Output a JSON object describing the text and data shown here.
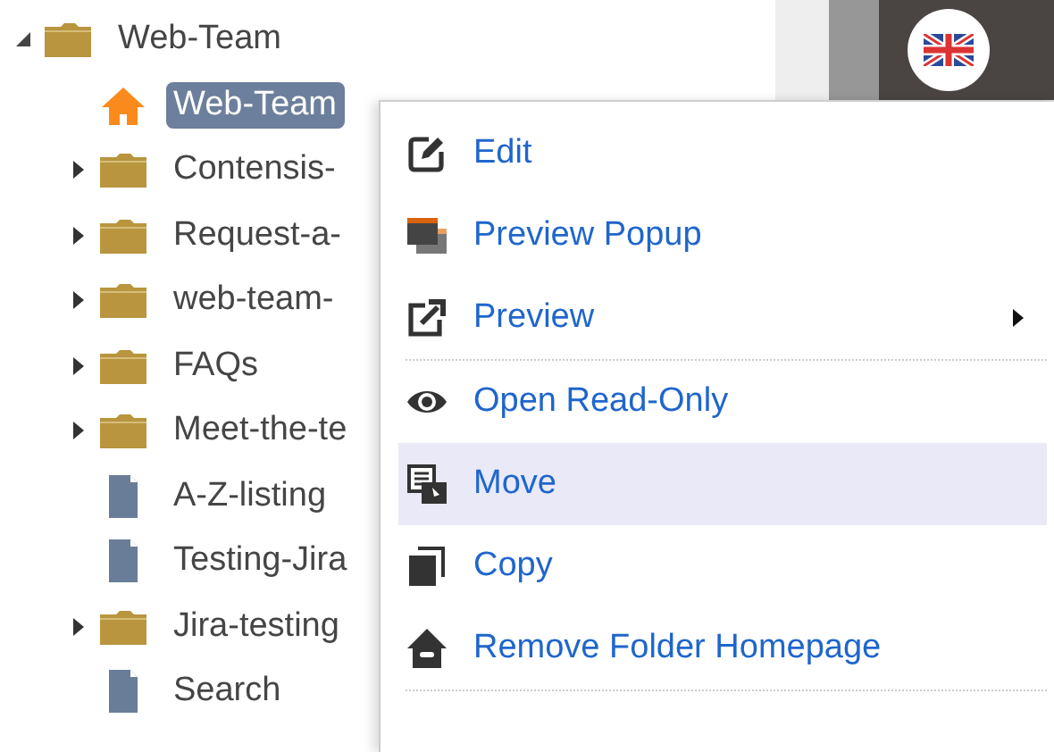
{
  "tree": [
    {
      "label": "Web-Team",
      "kind": "folder",
      "expanded": true,
      "selected": false,
      "children": [
        {
          "label": "Web-Team",
          "kind": "home",
          "selected": true
        },
        {
          "label": "Contensis-",
          "kind": "folder",
          "expanded": false,
          "selected": false
        },
        {
          "label": "Request-a-",
          "kind": "folder",
          "expanded": false,
          "selected": false
        },
        {
          "label": "web-team-",
          "kind": "folder",
          "expanded": false,
          "selected": false
        },
        {
          "label": "FAQs",
          "kind": "folder",
          "expanded": false,
          "selected": false
        },
        {
          "label": "Meet-the-te",
          "kind": "folder",
          "expanded": false,
          "selected": false
        },
        {
          "label": "A-Z-listing",
          "kind": "page",
          "selected": false
        },
        {
          "label": "Testing-Jira",
          "kind": "page",
          "selected": false
        },
        {
          "label": "Jira-testing",
          "kind": "folder",
          "expanded": false,
          "selected": false
        },
        {
          "label": "Search",
          "kind": "page",
          "selected": false
        }
      ]
    }
  ],
  "context_menu": [
    {
      "kind": "item",
      "label": "Edit",
      "submenu": false,
      "selected": false
    },
    {
      "kind": "item",
      "label": "Preview Popup",
      "submenu": false,
      "selected": false
    },
    {
      "kind": "item",
      "label": "Preview",
      "submenu": true,
      "selected": false
    },
    {
      "kind": "divider"
    },
    {
      "kind": "item",
      "label": "Open Read-Only",
      "submenu": false,
      "selected": false
    },
    {
      "kind": "item",
      "label": "Move",
      "submenu": false,
      "selected": true
    },
    {
      "kind": "item",
      "label": "Copy",
      "submenu": false,
      "selected": false
    },
    {
      "kind": "item",
      "label": "Remove Folder Homepage",
      "submenu": false,
      "selected": false
    },
    {
      "kind": "divider"
    }
  ]
}
